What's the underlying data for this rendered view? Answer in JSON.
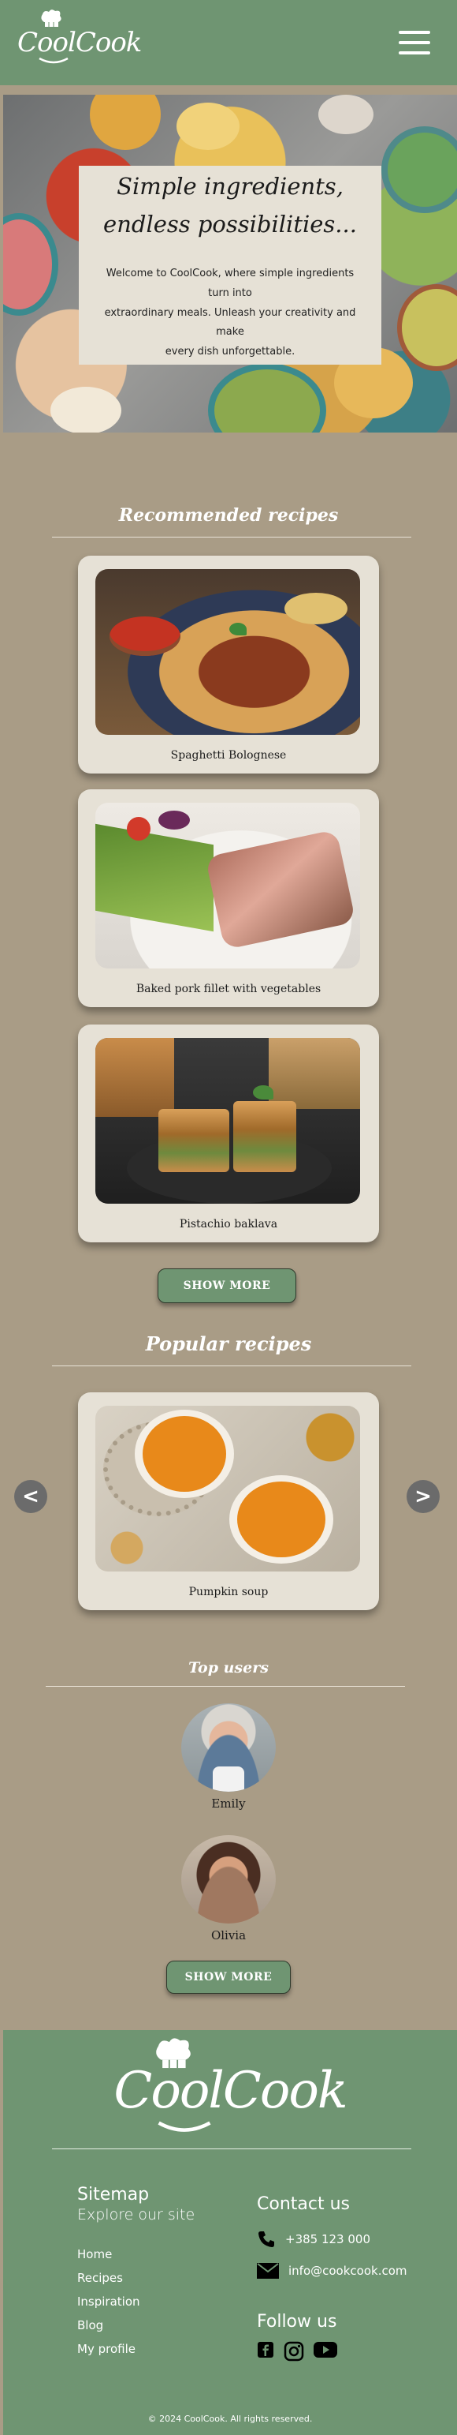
{
  "header": {
    "logo_text": "CoolCook",
    "menu_icon": "hamburger-menu-icon"
  },
  "hero": {
    "title_line1": "Simple ingredients,",
    "title_line2": "endless possibilities...",
    "text_line1": "Welcome to CoolCook, where simple ingredients turn into",
    "text_line2": "extraordinary meals.  Unleash your creativity and make",
    "text_line3": "every dish unforgettable."
  },
  "recommended": {
    "title": "Recommended recipes",
    "recipes": [
      {
        "name": "Spaghetti Bolognese"
      },
      {
        "name": "Baked pork fillet with vegetables"
      },
      {
        "name": "Pistachio baklava"
      }
    ],
    "button": "SHOW MORE"
  },
  "popular": {
    "title": "Popular recipes",
    "recipe": {
      "name": "Pumpkin soup"
    },
    "prev": "<",
    "next": ">"
  },
  "top_users": {
    "title": "Top users",
    "users": [
      {
        "name": "Emily"
      },
      {
        "name": "Olivia"
      }
    ],
    "button": "SHOW MORE"
  },
  "footer": {
    "logo_text": "CoolCook",
    "sitemap": {
      "title": "Sitemap",
      "subtitle": "Explore our site",
      "links": [
        "Home",
        "Recipes",
        "Inspiration",
        "Blog",
        "My profile"
      ]
    },
    "contact": {
      "title": "Contact us",
      "phone": "+385 123 000",
      "email": "info@cookcook.com"
    },
    "follow": {
      "title": "Follow us",
      "icons": [
        "facebook-icon",
        "instagram-icon",
        "youtube-icon"
      ]
    },
    "copyright": "© 2024 CoolCook. All rights reserved."
  },
  "colors": {
    "page_bg": "#a99c86",
    "brand_green": "#6f9572",
    "card_bg": "#e6e1d6"
  }
}
